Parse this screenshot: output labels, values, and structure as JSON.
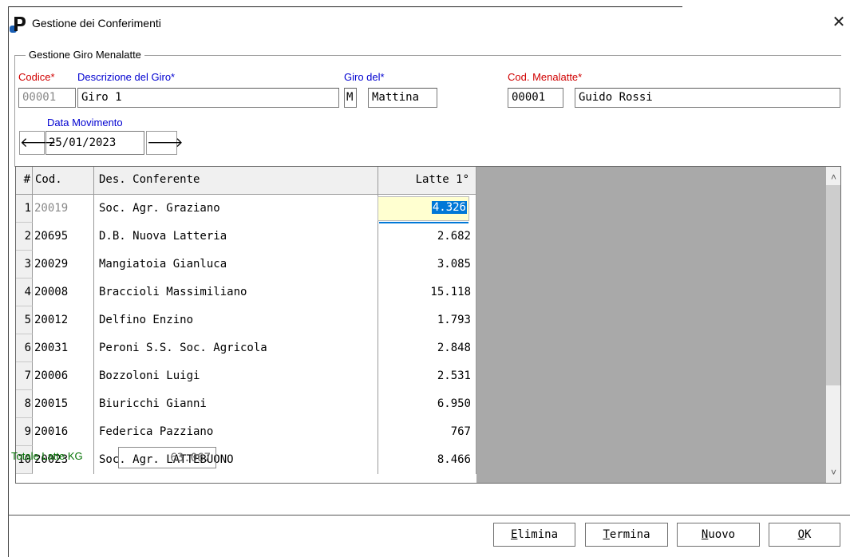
{
  "window": {
    "title": "Gestione dei Conferimenti",
    "close_glyph": "✕"
  },
  "group": {
    "legend": "Gestione Giro Menalatte"
  },
  "form": {
    "codice_label": "Codice*",
    "descrizione_label": "Descrizione del Giro*",
    "giro_del_label": "Giro del*",
    "cod_menalatte_label": "Cod. Menalatte*",
    "codice_value": "00001",
    "descrizione_value": "Giro 1",
    "giro_del_code": "M",
    "giro_del_value": "Mattina",
    "cod_menalatte_value": "00001",
    "menalatte_name": "Guido Rossi",
    "data_movimento_label": "Data Movimento",
    "data_movimento_value": "25/01/2023",
    "prev_glyph": "🡐",
    "next_glyph": "🡒"
  },
  "grid": {
    "headers": {
      "num": "#",
      "code": "Cod.",
      "desc": "Des. Conferente",
      "latte": "Latte 1°"
    },
    "rows": [
      {
        "num": "1",
        "code": "20019",
        "desc": "Soc. Agr. Graziano",
        "latte": "4.326"
      },
      {
        "num": "2",
        "code": "20695",
        "desc": "D.B. Nuova Latteria",
        "latte": "2.682"
      },
      {
        "num": "3",
        "code": "20029",
        "desc": "Mangiatoia Gianluca",
        "latte": "3.085"
      },
      {
        "num": "4",
        "code": "20008",
        "desc": "Braccioli Massimiliano",
        "latte": "15.118"
      },
      {
        "num": "5",
        "code": "20012",
        "desc": "Delfino Enzino",
        "latte": "1.793"
      },
      {
        "num": "6",
        "code": "20031",
        "desc": "Peroni S.S. Soc. Agricola",
        "latte": "2.848"
      },
      {
        "num": "7",
        "code": "20006",
        "desc": "Bozzoloni Luigi",
        "latte": "2.531"
      },
      {
        "num": "8",
        "code": "20015",
        "desc": "Biuricchi Gianni",
        "latte": "6.950"
      },
      {
        "num": "9",
        "code": "20016",
        "desc": "Federica Pazziano",
        "latte": "767"
      },
      {
        "num": "10",
        "code": "20023",
        "desc": "Soc. Agr. LATTEBUONO",
        "latte": "8.466"
      }
    ],
    "scroll_up_glyph": "˄",
    "scroll_down_glyph": "˅"
  },
  "totals": {
    "label": "Totale Latte KG",
    "value": "63.067"
  },
  "buttons": {
    "elimina_first": "E",
    "elimina_rest": "limina",
    "termina_first": "T",
    "termina_rest": "ermina",
    "nuovo_first": "N",
    "nuovo_rest": "uovo",
    "ok_first": "O",
    "ok_rest": "K"
  },
  "colors": {
    "required_label": "#d00000",
    "field_label": "#0000d0",
    "total_label": "#007000",
    "selection": "#0078d7",
    "grid_empty": "#a9a9a9"
  }
}
